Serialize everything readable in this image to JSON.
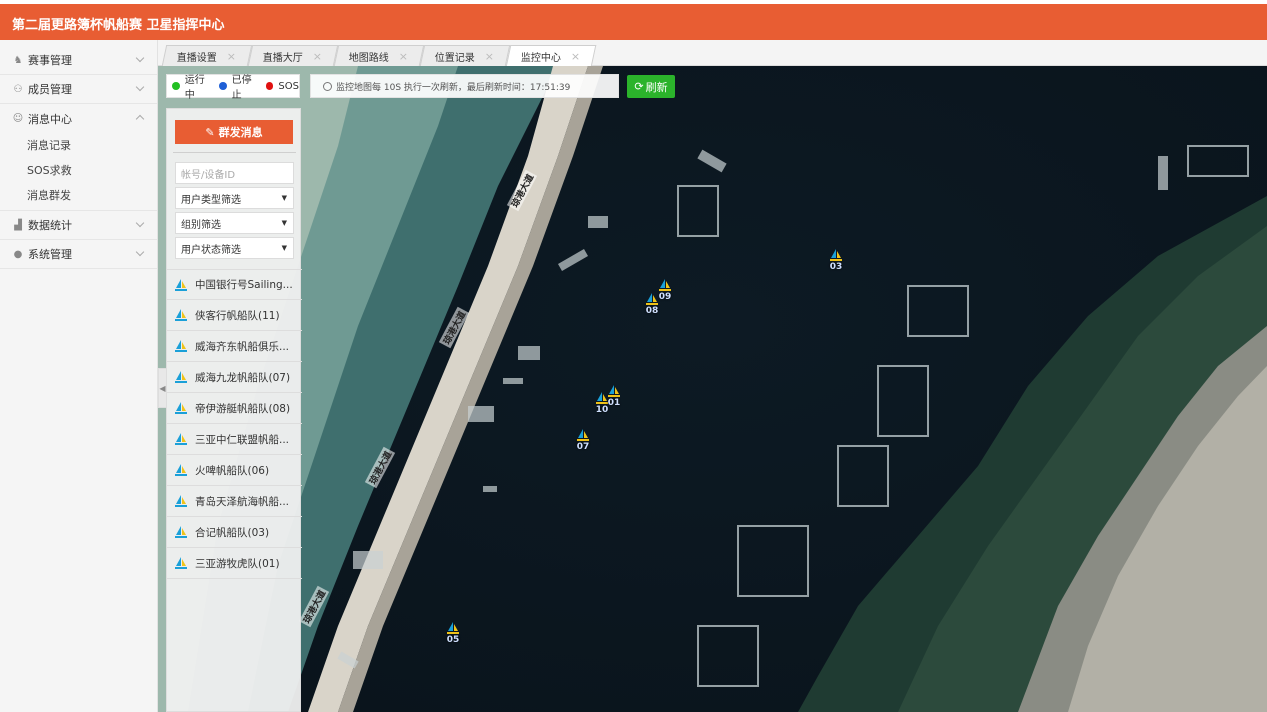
{
  "header": {
    "title": "第二届更路簿杯帆船赛 卫星指挥中心"
  },
  "sidebar": {
    "items": [
      {
        "label": "赛事管理",
        "icon": "trophy-icon"
      },
      {
        "label": "成员管理",
        "icon": "user-icon"
      },
      {
        "label": "消息中心",
        "icon": "message-icon",
        "children": [
          "消息记录",
          "SOS求救",
          "消息群发"
        ]
      },
      {
        "label": "数据统计",
        "icon": "chart-icon"
      },
      {
        "label": "系统管理",
        "icon": "settings-user-icon"
      }
    ]
  },
  "tabs": [
    {
      "label": "直播设置",
      "active": false
    },
    {
      "label": "直播大厅",
      "active": false
    },
    {
      "label": "地图路线",
      "active": false
    },
    {
      "label": "位置记录",
      "active": false
    },
    {
      "label": "监控中心",
      "active": true
    }
  ],
  "legend": {
    "running": "运行中",
    "stopped": "已停止",
    "sos": "SOS",
    "colors": {
      "running": "#22c022",
      "stopped": "#1e5fd6",
      "sos": "#e01010"
    }
  },
  "refresh": {
    "info": "监控地图每 10S 执行一次刷新，最后刷新时间：17:51:39",
    "button": "刷新"
  },
  "panel": {
    "send_button": "群发消息",
    "search_placeholder": "帐号/设备ID",
    "filters": [
      "用户类型筛选",
      "组别筛选",
      "用户状态筛选"
    ],
    "teams": [
      "中国银行号Sailing...",
      "侠客行帆船队(11)",
      "威海齐东帆船俱乐...",
      "威海九龙帆船队(07)",
      "帝伊游艇帆船队(08)",
      "三亚中仁联盟帆船...",
      "火啤帆船队(06)",
      "青岛天泽航海帆船...",
      "合记帆船队(03)",
      "三亚游牧虎队(01)"
    ]
  },
  "map": {
    "road_label": "琼港大道",
    "boats": [
      {
        "id": "03"
      },
      {
        "id": "09"
      },
      {
        "id": "08"
      },
      {
        "id": "10"
      },
      {
        "id": "01"
      },
      {
        "id": "07"
      },
      {
        "id": "05"
      }
    ]
  }
}
